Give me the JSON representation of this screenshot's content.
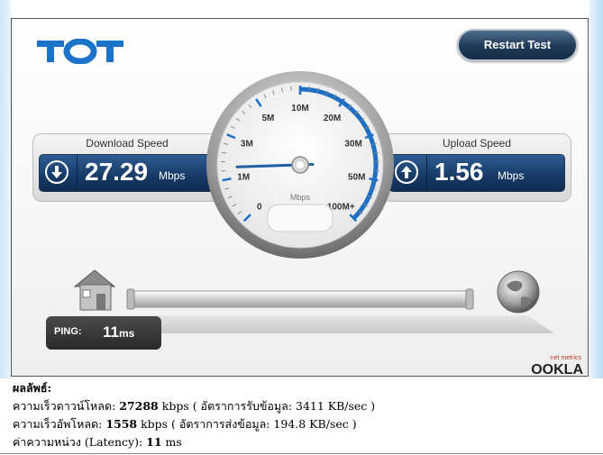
{
  "logo": {
    "text": "TOT",
    "color": "#1a73c8"
  },
  "restart_button": {
    "label": "Restart Test"
  },
  "download": {
    "title": "Download Speed",
    "value": "27.29",
    "unit": "Mbps",
    "icon": "arrow-down-icon"
  },
  "upload": {
    "title": "Upload Speed",
    "value": "1.56",
    "unit": "Mbps",
    "icon": "arrow-up-icon"
  },
  "gauge": {
    "unit_label": "Mbps",
    "scale_labels": [
      "0",
      "1M",
      "3M",
      "5M",
      "10M",
      "20M",
      "30M",
      "50M",
      "100M+"
    ],
    "needle_value_mbps": 1.56,
    "accent_color": "#1e6fc4"
  },
  "ping": {
    "label": "PING:",
    "value": "11",
    "unit": "ms"
  },
  "branding": {
    "small": "net metrics",
    "big": "OOKLA"
  },
  "results": {
    "heading": "ผลลัพธ์:",
    "download_line": {
      "prefix": "ความเร็วดาวน์โหลด: ",
      "value": "27288",
      "rest": " kbps ( อัตราการรับข้อมูล: 3411 KB/sec )"
    },
    "upload_line": {
      "prefix": "ความเร็วอัพโหลด: ",
      "value": "1558",
      "rest": " kbps ( อัตราการส่งข้อมูล: 194.8 KB/sec )"
    },
    "latency_line": {
      "prefix": "ค่าความหน่วง (Latency): ",
      "value": "11",
      "rest": " ms"
    }
  }
}
